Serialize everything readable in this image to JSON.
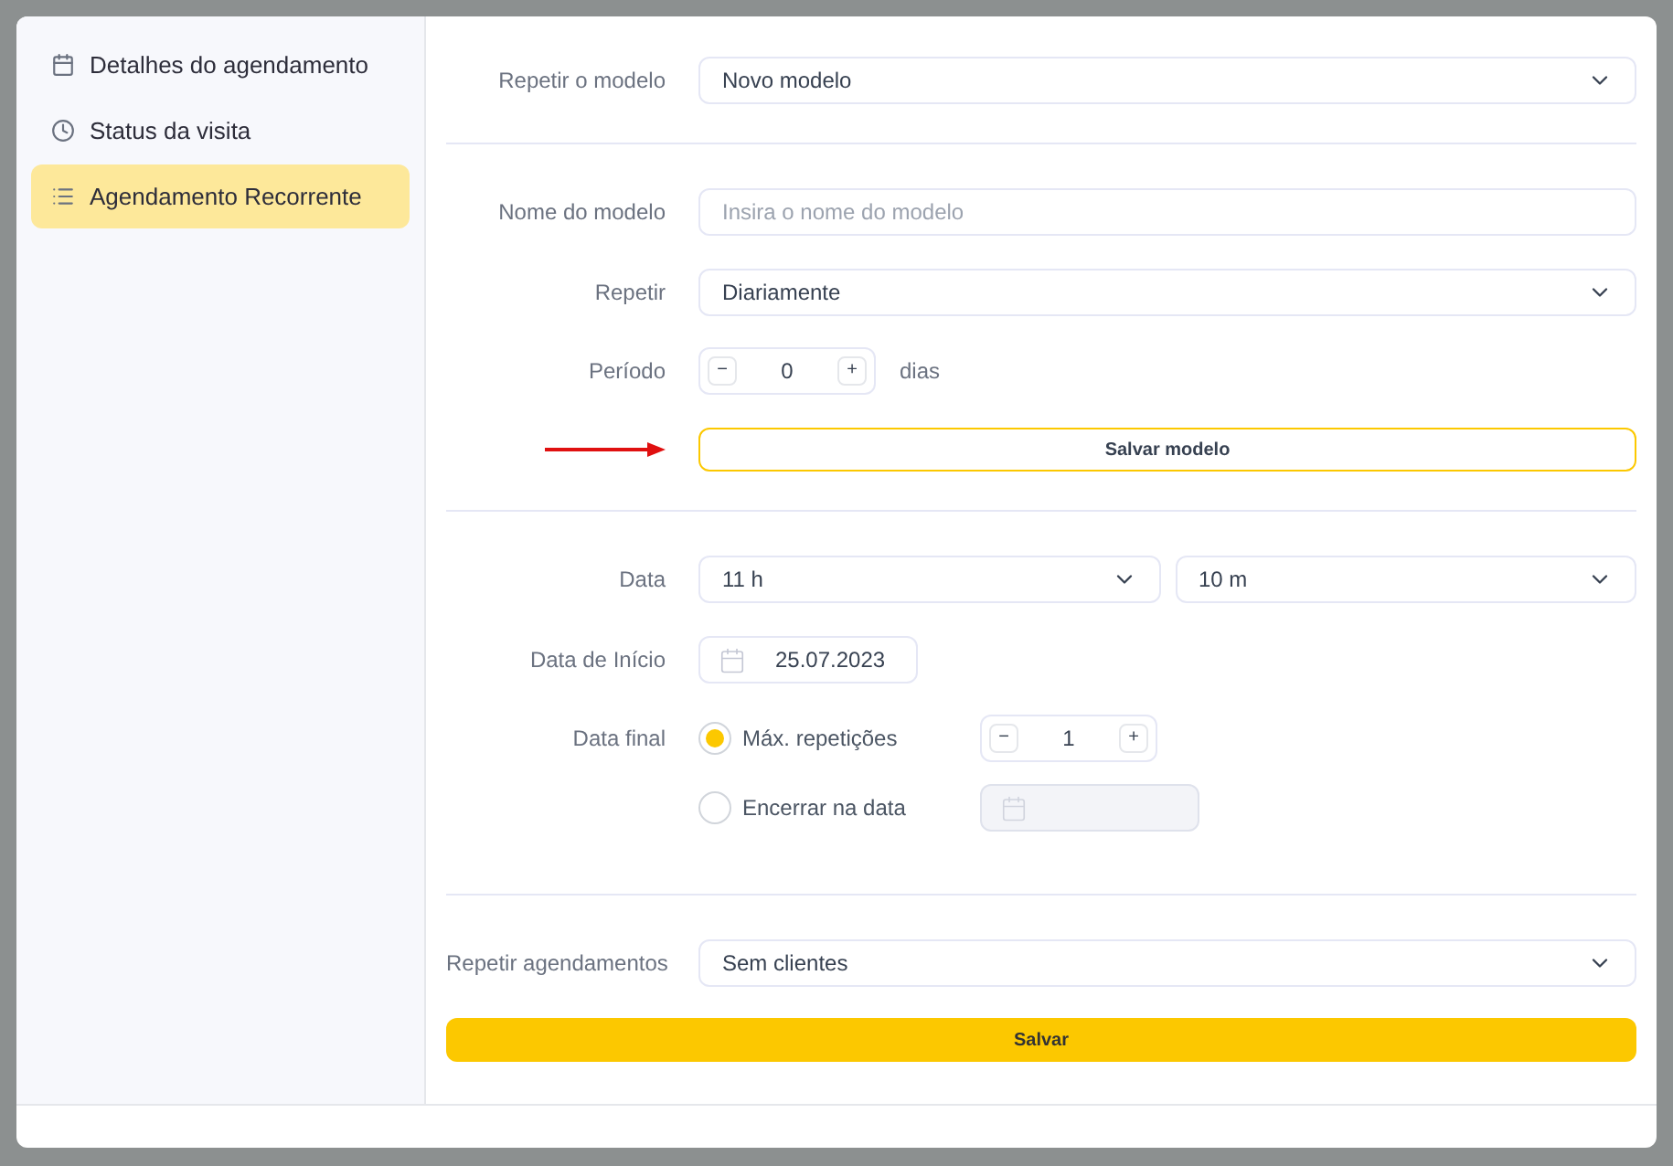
{
  "sidebar": {
    "items": [
      {
        "label": "Detalhes do agendamento",
        "selected": false
      },
      {
        "label": "Status da visita",
        "selected": false
      },
      {
        "label": "Agendamento Recorrente",
        "selected": true
      }
    ]
  },
  "template": {
    "label": "Repetir o modelo",
    "value": "Novo modelo"
  },
  "template_name": {
    "label": "Nome do modelo",
    "placeholder": "Insira o nome do modelo"
  },
  "repeat": {
    "label": "Repetir",
    "value": "Diariamente"
  },
  "period": {
    "label": "Período",
    "minus": "−",
    "value": "0",
    "plus": "+",
    "unit": "dias"
  },
  "save_template": {
    "label": "Salvar modelo"
  },
  "time": {
    "label": "Data",
    "hours": "11 h",
    "minutes": "10 m"
  },
  "start_date": {
    "label": "Data de Início",
    "value": "25.07.2023"
  },
  "end_date": {
    "label": "Data final",
    "options": [
      {
        "kind": "counter",
        "label": "Máx. repetições",
        "selected": true,
        "minus": "−",
        "value": "1",
        "plus": "+"
      },
      {
        "kind": "date",
        "label": "Encerrar na data",
        "selected": false
      }
    ]
  },
  "repeat_appointments": {
    "label": "Repetir agendamentos",
    "value": "Sem clientes"
  },
  "save": {
    "label": "Salvar"
  }
}
